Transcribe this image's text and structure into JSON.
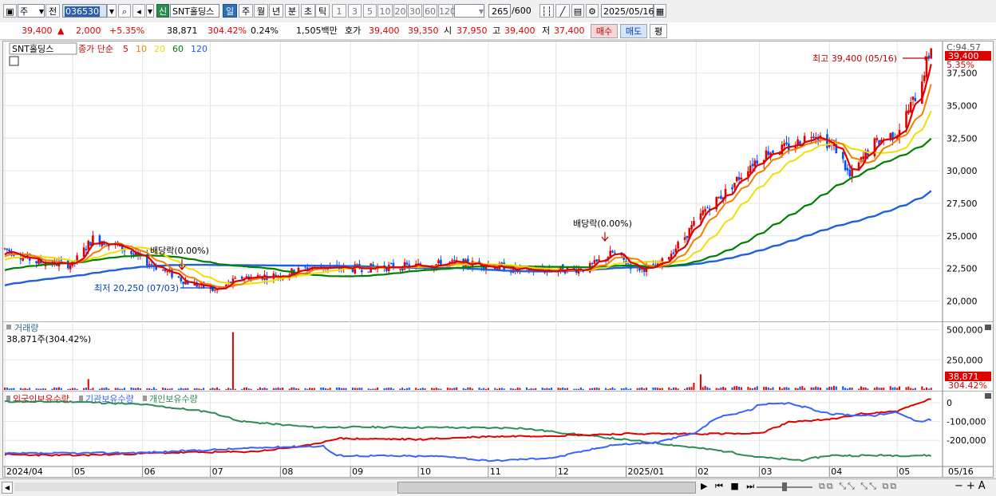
{
  "toolbar": {
    "period_type": "주",
    "prev_label": "전",
    "code": "036530",
    "new_badge": "신",
    "stock_name": "SNT홀딩스",
    "tabs": [
      "일",
      "주",
      "월",
      "년",
      "분",
      "초",
      "틱"
    ],
    "active_tab": "일",
    "intervals": [
      "1",
      "3",
      "5",
      "10",
      "20",
      "30",
      "60",
      "120"
    ],
    "count": "265",
    "count_max": "/600",
    "date": "2025/05/16"
  },
  "quote": {
    "price": "39,400",
    "direction": "▲",
    "change": "2,000",
    "change_pct": "+5.35%",
    "volume": "38,871",
    "volume_ratio": "304.42%",
    "turnover": "0.24%",
    "trade_value": "1,505백만",
    "bid_label": "호가",
    "ask_price": "39,400",
    "bid_price": "39,350",
    "open_label": "시",
    "open": "37,950",
    "high_label": "고",
    "high": "39,400",
    "low_label": "저",
    "low": "37,400",
    "buy_button": "매수",
    "sell_button": "매도",
    "eval_button": "평"
  },
  "colors": {
    "candle_up": "#e00000",
    "candle_down": "#0050ff",
    "ma5": "#e00000",
    "ma10": "#f08000",
    "ma20": "#f0e000",
    "ma60": "#008000",
    "ma120": "#1f5fe0",
    "foreign": "#e00000",
    "institution": "#3a62ff",
    "individual": "#2e8b57"
  },
  "chart_data": {
    "type": "candlestick",
    "price_panel": {
      "legend": {
        "name": "SNT홀딩스",
        "ma_title": "종가 단순",
        "periods": [
          "5",
          "10",
          "20",
          "60",
          "120"
        ]
      },
      "y_ticks": [
        "37,500",
        "35,000",
        "32,500",
        "30,000",
        "27,500",
        "25,000",
        "22,500",
        "20,000"
      ],
      "y_range": [
        18500,
        39800
      ],
      "right_labels": {
        "top": "C:94.57",
        "price": "39,400",
        "pct": "5.35%"
      },
      "annotations": {
        "high_label": "최고 39,400 (05/16)",
        "low_label": "최저 20,250 (07/03)",
        "dividend_label_1": "배당락(0.00%)",
        "dividend_label_2": "배당락(0.00%)"
      },
      "anchors": [
        [
          "2024-04-01",
          24000
        ],
        [
          "2024-04-15",
          23000
        ],
        [
          "2024-05-01",
          22800
        ],
        [
          "2024-05-10",
          24800
        ],
        [
          "2024-05-20",
          24300
        ],
        [
          "2024-06-05",
          22800
        ],
        [
          "2024-06-20",
          21500
        ],
        [
          "2024-07-03",
          20800
        ],
        [
          "2024-07-15",
          21800
        ],
        [
          "2024-08-01",
          22000
        ],
        [
          "2024-08-15",
          22600
        ],
        [
          "2024-09-01",
          22500
        ],
        [
          "2024-09-15",
          22600
        ],
        [
          "2024-10-01",
          22700
        ],
        [
          "2024-10-15",
          22900
        ],
        [
          "2024-11-01",
          22800
        ],
        [
          "2024-11-15",
          22300
        ],
        [
          "2024-12-01",
          22400
        ],
        [
          "2024-12-15",
          22500
        ],
        [
          "2024-12-26",
          23700
        ],
        [
          "2025-01-05",
          22500
        ],
        [
          "2025-01-15",
          22600
        ],
        [
          "2025-01-25",
          24500
        ],
        [
          "2025-02-05",
          27000
        ],
        [
          "2025-02-15",
          28500
        ],
        [
          "2025-02-25",
          30500
        ],
        [
          "2025-03-05",
          31500
        ],
        [
          "2025-03-15",
          31800
        ],
        [
          "2025-03-25",
          33000
        ],
        [
          "2025-04-05",
          31500
        ],
        [
          "2025-04-10",
          29500
        ],
        [
          "2025-04-20",
          32000
        ],
        [
          "2025-05-01",
          33000
        ],
        [
          "2025-05-10",
          36000
        ],
        [
          "2025-05-16",
          39400
        ]
      ]
    },
    "volume_panel": {
      "title": "거래량",
      "current": "38,871주(304.42%)",
      "y_ticks": [
        "500,000",
        "250,000"
      ],
      "y_max": 550000,
      "right_labels": {
        "value": "38,871",
        "pct": "304.42%"
      },
      "spikes": [
        [
          "2024-05-08",
          90000
        ],
        [
          "2024-07-11",
          480000
        ],
        [
          "2025-02-03",
          130000
        ],
        [
          "2025-01-31",
          60000
        ]
      ]
    },
    "holdings_panel": {
      "series": [
        "외국인보유수량",
        "기관보유수량",
        "개인보유수량"
      ],
      "y_ticks": [
        "0",
        "-100,000",
        "-200,000"
      ],
      "y_range": [
        -330000,
        50000
      ],
      "foreign": [
        [
          "2024-04-01",
          -275000
        ],
        [
          "2024-05-01",
          -280000
        ],
        [
          "2024-06-15",
          -265000
        ],
        [
          "2024-07-20",
          -260000
        ],
        [
          "2024-08-15",
          -225000
        ],
        [
          "2024-08-25",
          -190000
        ],
        [
          "2024-10-01",
          -195000
        ],
        [
          "2024-10-31",
          -180000
        ],
        [
          "2024-12-01",
          -175000
        ],
        [
          "2025-01-01",
          -165000
        ],
        [
          "2025-02-01",
          -165000
        ],
        [
          "2025-03-01",
          -165000
        ],
        [
          "2025-03-15",
          -100000
        ],
        [
          "2025-04-01",
          -90000
        ],
        [
          "2025-04-15",
          -60000
        ],
        [
          "2025-05-01",
          -45000
        ],
        [
          "2025-05-16",
          20000
        ]
      ],
      "institution": [
        [
          "2024-04-01",
          -270000
        ],
        [
          "2024-06-01",
          -265000
        ],
        [
          "2024-08-01",
          -235000
        ],
        [
          "2024-08-20",
          -230000
        ],
        [
          "2024-08-25",
          -280000
        ],
        [
          "2024-10-15",
          -285000
        ],
        [
          "2024-11-01",
          -310000
        ],
        [
          "2024-12-01",
          -290000
        ],
        [
          "2024-12-25",
          -225000
        ],
        [
          "2025-01-15",
          -210000
        ],
        [
          "2025-02-01",
          -160000
        ],
        [
          "2025-02-10",
          -80000
        ],
        [
          "2025-02-25",
          -40000
        ],
        [
          "2025-03-01",
          -10000
        ],
        [
          "2025-03-15",
          -5000
        ],
        [
          "2025-04-01",
          -60000
        ],
        [
          "2025-04-20",
          -70000
        ],
        [
          "2025-05-01",
          -50000
        ],
        [
          "2025-05-10",
          -100000
        ],
        [
          "2025-05-16",
          -90000
        ]
      ],
      "individual": [
        [
          "2024-04-01",
          5000
        ],
        [
          "2024-05-01",
          5000
        ],
        [
          "2024-06-01",
          -10000
        ],
        [
          "2024-07-01",
          -50000
        ],
        [
          "2024-07-15",
          -100000
        ],
        [
          "2024-08-15",
          -130000
        ],
        [
          "2024-09-15",
          -130000
        ],
        [
          "2024-11-15",
          -135000
        ],
        [
          "2024-12-15",
          -175000
        ],
        [
          "2025-01-15",
          -215000
        ],
        [
          "2025-02-15",
          -260000
        ],
        [
          "2025-03-01",
          -290000
        ],
        [
          "2025-03-20",
          -305000
        ],
        [
          "2025-04-01",
          -280000
        ],
        [
          "2025-05-01",
          -280000
        ],
        [
          "2025-05-16",
          -280000
        ]
      ]
    },
    "x_axis": {
      "range": [
        "2024-04-01",
        "2025-05-20"
      ],
      "ticks": [
        {
          "label": "2024/04",
          "date": "2024-04-01"
        },
        {
          "label": "05",
          "date": "2024-05-01"
        },
        {
          "label": "06",
          "date": "2024-06-01"
        },
        {
          "label": "07",
          "date": "2024-07-01"
        },
        {
          "label": "08",
          "date": "2024-08-01"
        },
        {
          "label": "09",
          "date": "2024-09-01"
        },
        {
          "label": "10",
          "date": "2024-10-01"
        },
        {
          "label": "11",
          "date": "2024-11-01"
        },
        {
          "label": "12",
          "date": "2024-12-01"
        },
        {
          "label": "2025/01",
          "date": "2025-01-01"
        },
        {
          "label": "02",
          "date": "2025-02-01"
        },
        {
          "label": "03",
          "date": "2025-03-01"
        },
        {
          "label": "04",
          "date": "2025-04-01"
        },
        {
          "label": "05",
          "date": "2025-05-01"
        }
      ],
      "end_label": "05/16"
    }
  }
}
